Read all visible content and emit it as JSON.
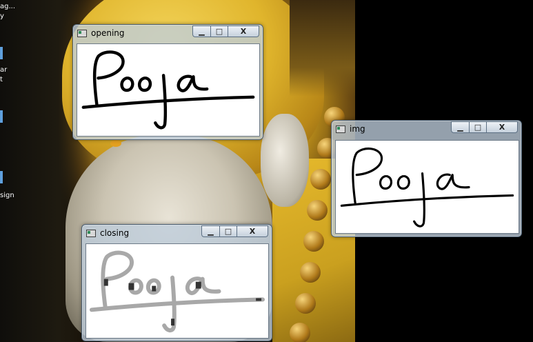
{
  "desktop": {
    "icon_labels": [
      "ag...",
      "y",
      "ar",
      "t",
      "sign"
    ]
  },
  "windows": [
    {
      "title": "opening",
      "controls": {
        "minimize": "▁",
        "maximize": "□",
        "close": "X"
      },
      "image_text": "Pooja"
    },
    {
      "title": "img",
      "controls": {
        "minimize": "▁",
        "maximize": "□",
        "close": "X"
      },
      "image_text": "Pooja"
    },
    {
      "title": "closing",
      "controls": {
        "minimize": "▁",
        "maximize": "□",
        "close": "X"
      },
      "image_text": "Pooja"
    }
  ]
}
